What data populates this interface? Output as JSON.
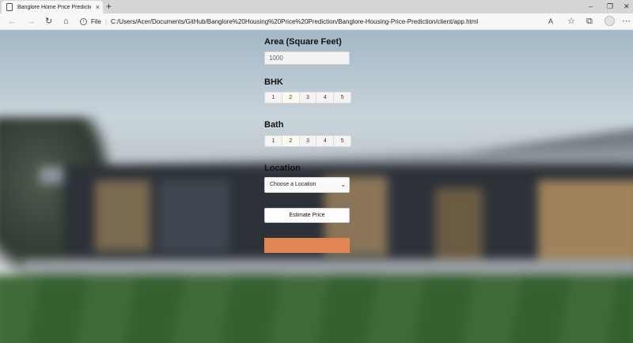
{
  "browser": {
    "tab_title": "Banglore Home Price Prediction",
    "tab_close": "×",
    "new_tab": "+",
    "window_controls": {
      "minimize": "–",
      "restore": "❐",
      "close": "✕"
    },
    "nav": {
      "back": "←",
      "forward": "→",
      "refresh": "↻",
      "home": "⌂"
    },
    "address": {
      "info": "i",
      "scheme": "File",
      "url": "C:/Users/Acer/Documents/GitHub/Banglore%20Housing%20Price%20Prediction/Banglore-Housing-Price-Prediction/client/app.html"
    },
    "toolbar_icons": {
      "read_aloud": "A",
      "favorites": "☆",
      "collections": "⧉",
      "profile": "👤",
      "menu": "⋯"
    }
  },
  "form": {
    "area_label": "Area (Square Feet)",
    "area_value": "1000",
    "bhk_label": "BHK",
    "bhk_options": [
      "1",
      "2",
      "3",
      "4",
      "5"
    ],
    "bhk_selected": "2",
    "bath_label": "Bath",
    "bath_options": [
      "1",
      "2",
      "3",
      "4",
      "5"
    ],
    "bath_selected": "2",
    "location_label": "Location",
    "location_value": "Choose a Location",
    "location_chevron": "⌄",
    "estimate_button": "Estimate Price"
  },
  "colors": {
    "result_bar": "#df8652",
    "option_text": "#7a2020"
  }
}
